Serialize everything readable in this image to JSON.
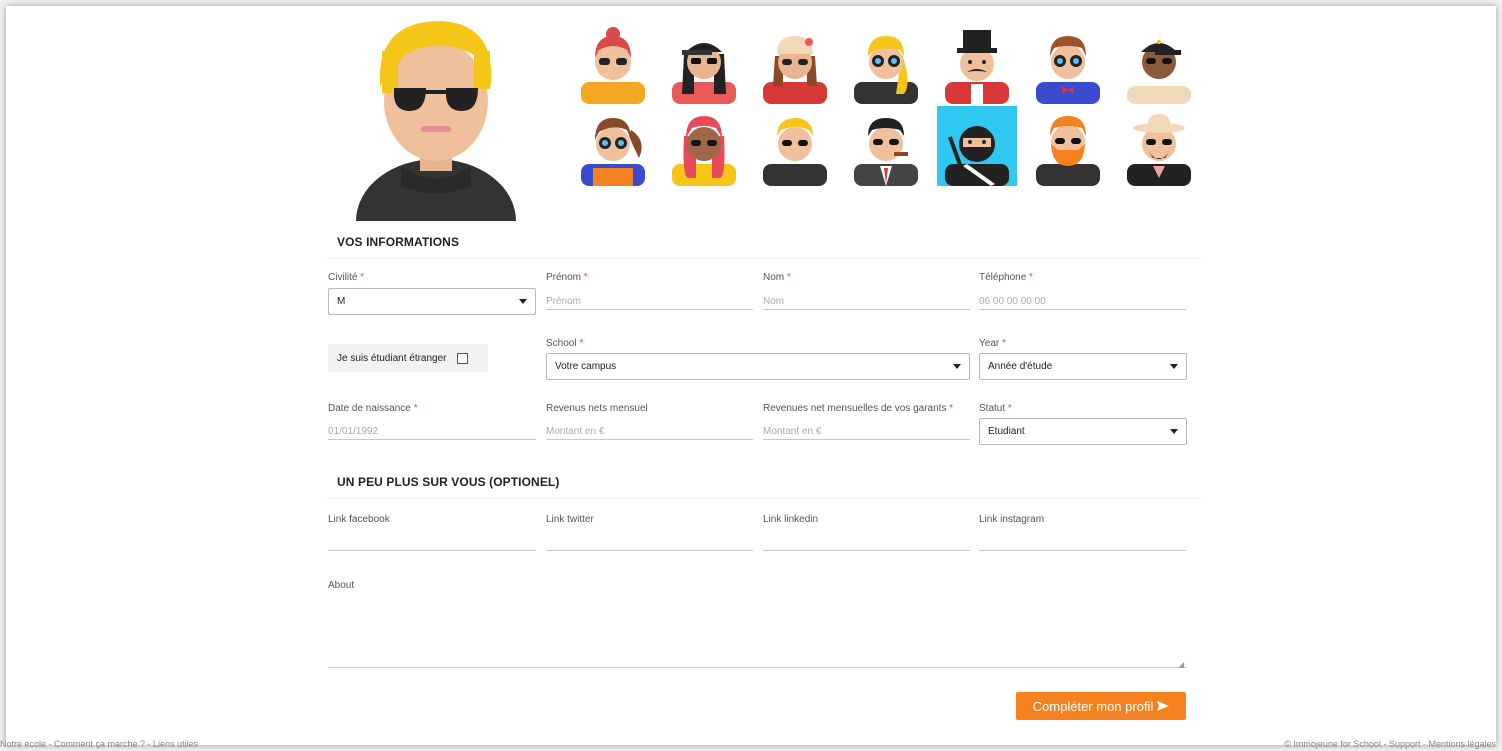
{
  "colors": {
    "accent": "#f5821f",
    "selected": "#2fc8f0",
    "required": "#e74c3c"
  },
  "avatars": {
    "current": "avatar-blond-sunglasses",
    "row1": [
      "avatar-red-hair-girl",
      "avatar-cap-girl",
      "avatar-flower-hat-girl",
      "avatar-blonde-girl",
      "avatar-top-hat-magician",
      "avatar-bowtie-guy",
      "avatar-cap-woman"
    ],
    "row2": [
      "avatar-ponytail-girl",
      "avatar-pink-hair-girl",
      "avatar-blond-guy",
      "avatar-mafia-cigar",
      "avatar-ninja",
      "avatar-ginger-beard",
      "avatar-panama-hat"
    ],
    "selected_index": "ninja"
  },
  "section1": {
    "title": "VOS INFORMATIONS"
  },
  "fields": {
    "civilite": {
      "label": "Civilité",
      "req": "*",
      "value": "M"
    },
    "prenom": {
      "label": "Prénom",
      "req": "*",
      "placeholder": "Prénom"
    },
    "nom": {
      "label": "Nom",
      "req": "*",
      "placeholder": "Nom"
    },
    "telephone": {
      "label": "Téléphone",
      "req": "*",
      "placeholder": "06 00 00 00 00"
    },
    "etranger": {
      "label": "Je suis étudiant étranger"
    },
    "school": {
      "label": "School",
      "req": "*",
      "value": "Votre campus"
    },
    "year": {
      "label": "Year",
      "req": "*",
      "value": "Année d'étude"
    },
    "naissance": {
      "label": "Date de naissance",
      "req": "*",
      "placeholder": "01/01/1992"
    },
    "revenus": {
      "label": "Revenus nets mensuel",
      "placeholder": "Montant en €"
    },
    "garants": {
      "label": "Revenues net mensuelles de vos garants",
      "req": "*",
      "placeholder": "Montant en €"
    },
    "statut": {
      "label": "Statut",
      "req": "*",
      "value": "Etudiant"
    }
  },
  "section2": {
    "title": "UN PEU PLUS SUR VOUS (OPTIONEL)"
  },
  "links": {
    "facebook": "Link facebook",
    "twitter": "Link twitter",
    "linkedin": "Link linkedin",
    "instagram": "Link instagram",
    "about": "About"
  },
  "submit": {
    "label": "Compléter mon profil",
    "icon": "send-arrow-icon"
  },
  "footer": {
    "left": "Notre école - Comment ça marche ? - Liens utiles",
    "right": "© Immojeune for School - Support - Mentions légales"
  }
}
